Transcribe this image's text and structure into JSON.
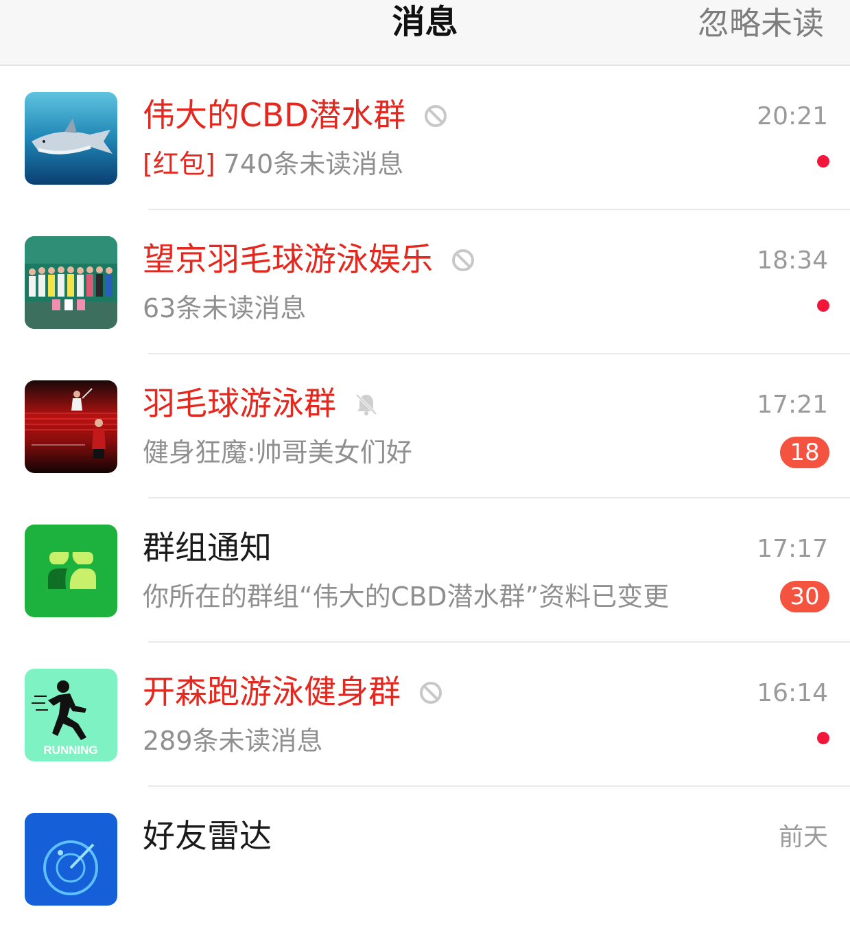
{
  "header": {
    "title": "消息",
    "ignore_unread_label": "忽略未读"
  },
  "conversations": [
    {
      "name": "伟大的CBD潜水群",
      "name_color": "red",
      "status_icon": "block-icon",
      "preview_tag": "[红包]",
      "preview": " 740条未读消息",
      "time": "20:21",
      "indicator": "dot",
      "avatar": "shark-photo-avatar"
    },
    {
      "name": "望京羽毛球游泳娱乐",
      "name_color": "red",
      "status_icon": "block-icon",
      "preview_tag": "",
      "preview": "63条未读消息",
      "time": "18:34",
      "indicator": "dot",
      "avatar": "group-photo-avatar"
    },
    {
      "name": "羽毛球游泳群",
      "name_color": "red",
      "status_icon": "mute-bell-icon",
      "preview_tag": "",
      "preview": "健身狂魔:帅哥美女们好",
      "time": "17:21",
      "indicator": "badge",
      "badge": "18",
      "avatar": "badminton-poster-avatar"
    },
    {
      "name": "群组通知",
      "name_color": "dark",
      "status_icon": "",
      "preview_tag": "",
      "preview": "你所在的群组“伟大的CBD潜水群”资料已变更",
      "time": "17:17",
      "indicator": "badge",
      "badge": "30",
      "avatar": "group-notice-avatar"
    },
    {
      "name": "开森跑游泳健身群",
      "name_color": "red",
      "status_icon": "block-icon",
      "preview_tag": "",
      "preview": "289条未读消息",
      "time": "16:14",
      "indicator": "dot",
      "avatar": "running-avatar",
      "avatar_text": "RUNNING"
    },
    {
      "name": "好友雷达",
      "name_color": "dark",
      "status_icon": "",
      "preview_tag": "",
      "preview": "",
      "time": "前天",
      "indicator": "none",
      "avatar": "radar-avatar"
    }
  ],
  "colors": {
    "accent_red": "#e3281f",
    "unread_dot": "#f2163a",
    "badge_bg": "#f4533f"
  }
}
